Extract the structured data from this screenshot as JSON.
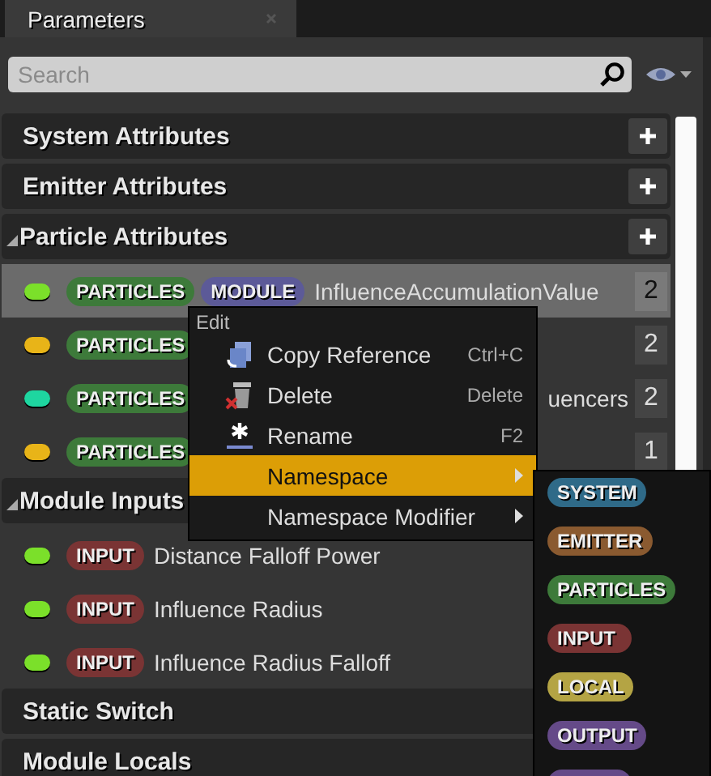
{
  "tab": {
    "title": "Parameters"
  },
  "search": {
    "placeholder": "Search"
  },
  "sections": [
    {
      "title": "System Attributes",
      "expanded": false,
      "addable": true
    },
    {
      "title": "Emitter Attributes",
      "expanded": false,
      "addable": true
    },
    {
      "title": "Particle Attributes",
      "expanded": true,
      "addable": true,
      "rows": [
        {
          "color": "#7be02a",
          "tags": [
            {
              "label": "PARTICLES",
              "color": "#3d7a3a"
            },
            {
              "label": "MODULE",
              "color": "#5c5a98"
            }
          ],
          "name": "InfluenceAccumulationValue",
          "name_clipped": false,
          "count": "2",
          "selected": true
        },
        {
          "color": "#e8b418",
          "tags": [
            {
              "label": "PARTICLES",
              "color": "#3d7a3a"
            }
          ],
          "count": "2",
          "selected": false
        },
        {
          "color": "#1ed6a0",
          "tags": [
            {
              "label": "PARTICLES",
              "color": "#3d7a3a"
            }
          ],
          "name": "uencers",
          "name_clipped": true,
          "count": "2",
          "selected": false
        },
        {
          "color": "#e8b418",
          "tags": [
            {
              "label": "PARTICLES",
              "color": "#3d7a3a"
            }
          ],
          "count": "1",
          "selected": false
        }
      ]
    },
    {
      "title": "Module Inputs",
      "expanded": true,
      "addable": false,
      "rows": [
        {
          "color": "#7be02a",
          "tags": [
            {
              "label": "INPUT",
              "color": "#7a3434"
            }
          ],
          "name": "Distance Falloff Power",
          "name_clipped": false,
          "selected": false
        },
        {
          "color": "#7be02a",
          "tags": [
            {
              "label": "INPUT",
              "color": "#7a3434"
            }
          ],
          "name": "Influence Radius",
          "name_clipped": false,
          "selected": false
        },
        {
          "color": "#7be02a",
          "tags": [
            {
              "label": "INPUT",
              "color": "#7a3434"
            }
          ],
          "name": "Influence Radius Falloff",
          "name_clipped": false,
          "selected": false
        }
      ]
    },
    {
      "title": "Static Switch",
      "expanded": false,
      "addable": false
    },
    {
      "title": "Module Locals",
      "expanded": false,
      "addable": false
    }
  ],
  "context_menu": {
    "heading": "Edit",
    "items": [
      {
        "kind": "copy",
        "label": "Copy Reference",
        "shortcut": "Ctrl+C",
        "submenu": false,
        "selected": false
      },
      {
        "kind": "delete",
        "label": "Delete",
        "shortcut": "Delete",
        "submenu": false,
        "selected": false
      },
      {
        "kind": "rename",
        "label": "Rename",
        "shortcut": "F2",
        "submenu": false,
        "selected": false
      },
      {
        "kind": "plain",
        "label": "Namespace",
        "submenu": true,
        "selected": true
      },
      {
        "kind": "plain",
        "label": "Namespace Modifier",
        "submenu": true,
        "selected": false
      }
    ]
  },
  "submenu": {
    "items": [
      {
        "label": "SYSTEM",
        "color": "#2f6a88"
      },
      {
        "label": "EMITTER",
        "color": "#8a5a30"
      },
      {
        "label": "PARTICLES",
        "color": "#3d7a3a"
      },
      {
        "label": "INPUT",
        "color": "#7a3434"
      },
      {
        "label": "LOCAL",
        "color": "#b4a444"
      },
      {
        "label": "OUTPUT",
        "color": "#654a88"
      },
      {
        "color": "#654a88"
      }
    ]
  }
}
